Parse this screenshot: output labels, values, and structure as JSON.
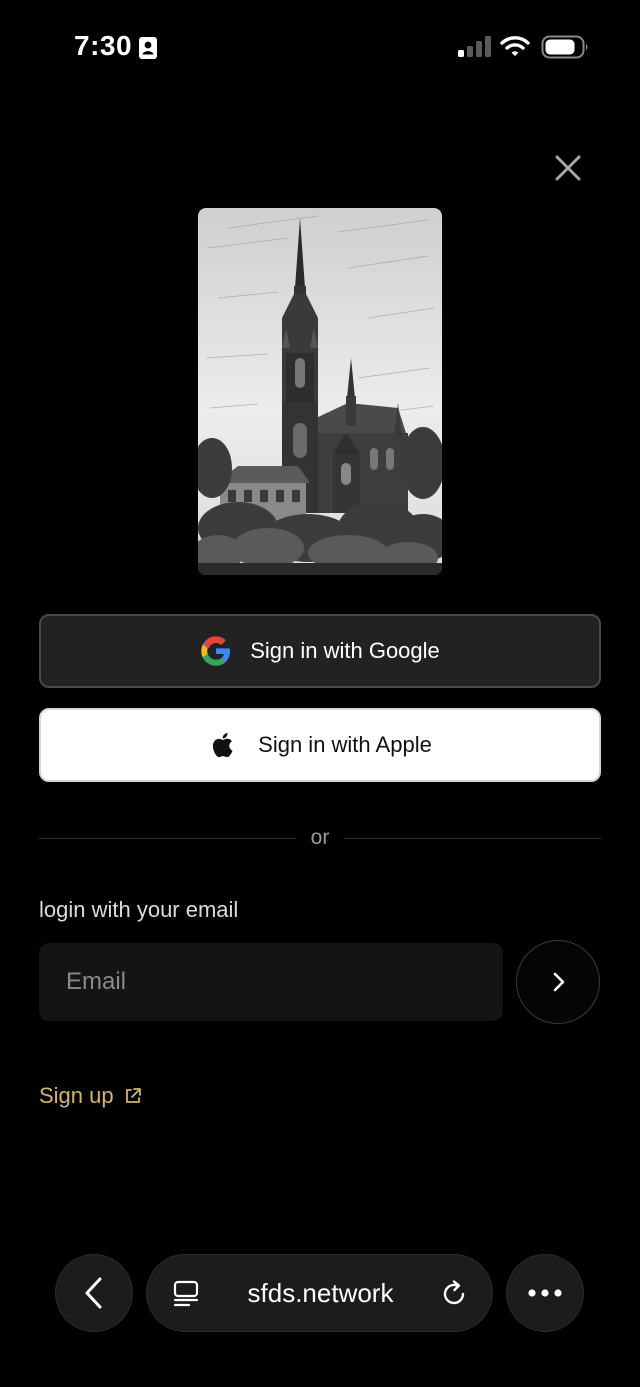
{
  "status_bar": {
    "time": "7:30",
    "icons": [
      "contact-card-icon",
      "cellular-signal-icon",
      "wifi-icon",
      "battery-icon"
    ]
  },
  "dialog": {
    "close_icon": "close-icon",
    "artwork": "cathedral-pencil-sketch",
    "google_button": {
      "label": "Sign in with Google",
      "icon": "google-logo-icon"
    },
    "apple_button": {
      "label": "Sign in with Apple",
      "icon": "apple-logo-icon"
    },
    "divider_text": "or",
    "email_section": {
      "label": "login with your email",
      "placeholder": "Email",
      "value": "",
      "submit_icon": "chevron-right-icon"
    },
    "signup": {
      "label": "Sign up",
      "icon": "external-link-icon"
    }
  },
  "browser_bar": {
    "back_icon": "chevron-left-icon",
    "reader_icon": "reader-mode-icon",
    "url": "sfds.network",
    "reload_icon": "reload-icon",
    "more_icon": "more-icon"
  },
  "colors": {
    "background": "#000000",
    "google_button_bg": "#222222",
    "apple_button_bg": "#ffffff",
    "input_bg": "#141414",
    "accent_link": "#d4b56a",
    "browser_controls_bg": "#1c1c1c"
  }
}
